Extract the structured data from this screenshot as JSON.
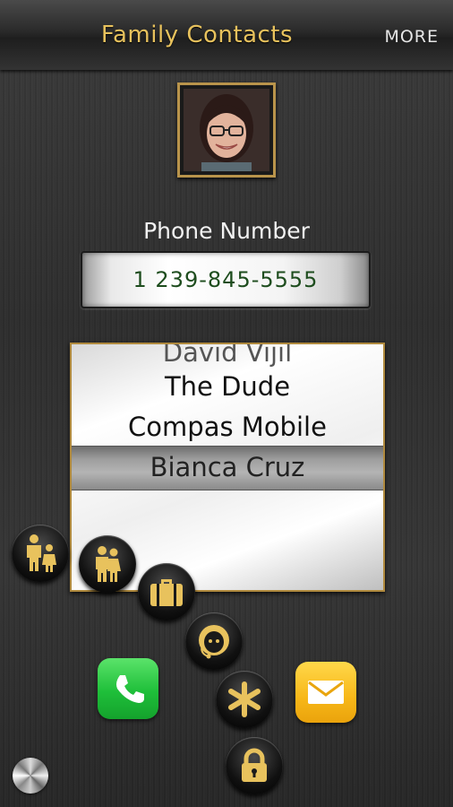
{
  "header": {
    "title": "Family Contacts",
    "more_label": "MORE"
  },
  "contact": {
    "photo_icon": "contact-photo"
  },
  "phone": {
    "label": "Phone Number",
    "value": "1 239-845-5555"
  },
  "picker": {
    "items": [
      "David Vijil",
      "The Dude",
      "Compas Mobile",
      "Bianca Cruz"
    ],
    "selected": "Bianca Cruz"
  },
  "actions": {
    "icons": [
      "family-icon",
      "couple-icon",
      "briefcase-icon",
      "support-agent-icon",
      "asterisk-icon",
      "lock-icon",
      "phone-call-icon",
      "mail-icon",
      "settings-knob-icon"
    ]
  },
  "colors": {
    "accent_gold": "#e8c25d",
    "frame_gold": "#b9944b",
    "phone_text": "#1e4d1e",
    "call_green": "#1fbf3a",
    "mail_yellow": "#f7b718"
  }
}
